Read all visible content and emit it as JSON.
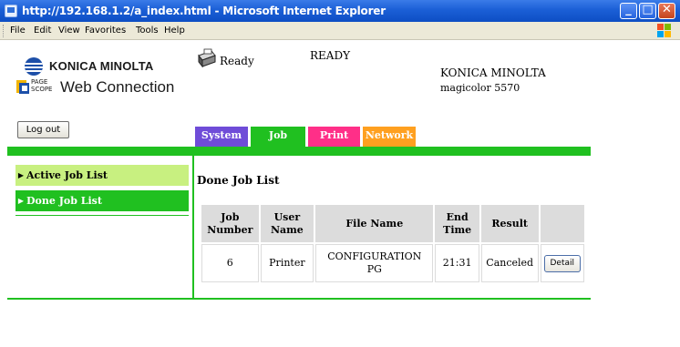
{
  "window": {
    "title": "http://192.168.1.2/a_index.html - Microsoft Internet Explorer",
    "buttons": {
      "minimize": "_",
      "maximize": "□",
      "close": "✕"
    }
  },
  "menubar": {
    "items": [
      {
        "label": "File"
      },
      {
        "label": "Edit"
      },
      {
        "label": "View"
      },
      {
        "label": "Favorites"
      },
      {
        "label": "Tools"
      },
      {
        "label": "Help"
      }
    ]
  },
  "header": {
    "brand": "KONICA MINOLTA",
    "pagescope_top": "PAGE",
    "pagescope_bottom": "SCOPE",
    "web_connection": "Web Connection",
    "status": "Ready",
    "status_upper": "READY",
    "device_maker": "KONICA MINOLTA",
    "device_model": "magicolor 5570"
  },
  "logout_label": "Log out",
  "tabs": [
    {
      "label": "System",
      "color": "#6f4cd8"
    },
    {
      "label": "Job",
      "color": "#20c020"
    },
    {
      "label": "Print",
      "color": "#ff2f88"
    },
    {
      "label": "Network",
      "color": "#ffa020"
    }
  ],
  "sidebar": {
    "items": [
      {
        "label": "Active Job List"
      },
      {
        "label": "Done Job List"
      }
    ]
  },
  "main": {
    "title": "Done Job List",
    "table": {
      "headers": {
        "job_number_1": "Job",
        "job_number_2": "Number",
        "user_name_1": "User",
        "user_name_2": "Name",
        "file_name": "File Name",
        "end_time_1": "End",
        "end_time_2": "Time",
        "result": "Result"
      },
      "rows": [
        {
          "job_number": "6",
          "user_name": "Printer",
          "file_name_1": "CONFIGURATION",
          "file_name_2": "PG",
          "end_time": "21:31",
          "result": "Canceled",
          "detail": "Detail"
        }
      ]
    }
  },
  "colors": {
    "accent_green": "#20c020",
    "sidebar_active": "#c8f080"
  }
}
